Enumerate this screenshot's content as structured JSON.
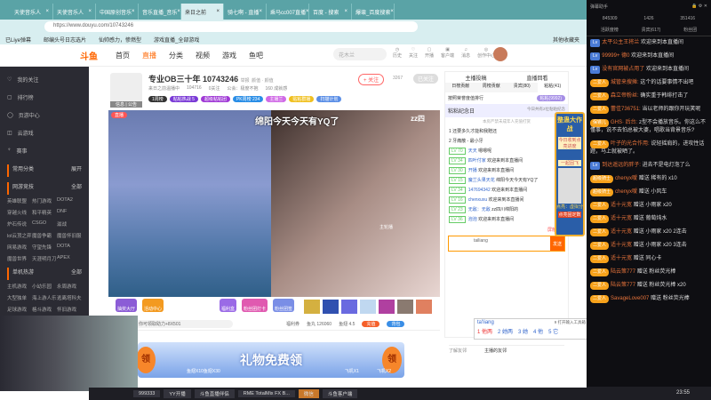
{
  "browser": {
    "tabs": [
      "天使音乐人",
      "天使音乐人",
      "中国原创音乐",
      "音乐直播_音乐",
      "来日之前",
      "骑七啊 - 直播",
      "乘马cc007直播",
      "百度 - 搜索",
      "爆壊_百度搜索"
    ],
    "active_tab": 4,
    "url": "https://www.douyu.com/10743246",
    "bookmarks": [
      "已Liye弹幕",
      "邮编头号日志选片",
      "仙帅感力，惨燃型",
      "游戏直播_全部游戏"
    ],
    "bookmarks_right": "其他收藏夹"
  },
  "header": {
    "logo": "斗鱼",
    "nav": [
      "首页",
      "直播",
      "分类",
      "视频",
      "游戏",
      "鱼吧"
    ],
    "search_placeholder": "花木兰",
    "icons": [
      "历史",
      "关注",
      "开播",
      "客户端",
      "消息",
      "创作中心"
    ]
  },
  "sidebar": {
    "items": [
      "我的关注",
      "排行榜",
      "页游中心",
      "云游戏",
      "赛事"
    ],
    "common": "常用分类",
    "common_more": "展开",
    "section1": "网游竞技",
    "section1_more": "全部",
    "games1": [
      "英雄联盟",
      "热门游戏",
      "DOTA2",
      "穿越火线",
      "和平精英",
      "DNF",
      "炉石传说",
      "CSGO",
      "滋战",
      "lol云顶之弈",
      "魔兽争霸",
      "魔兽怀旧服",
      "网易游戏",
      "守望先锋",
      "DOTA",
      "魔兽世界",
      "天涯明月刀",
      "APEX"
    ],
    "section2": "单机热游",
    "section2_more": "全部",
    "games2": [
      "主机游戏",
      "小幼乐园",
      "永周游戏",
      "大型独单",
      "海上游人乐",
      "逃离塔科夫",
      "足球游戏",
      "格斗游戏",
      "怀旧游戏"
    ]
  },
  "streamer": {
    "name": "专业OB三十年",
    "room": "10743246",
    "report": "举报",
    "tags": "颜值 · 颜值",
    "category": "来日之前温播中",
    "heat": "104716",
    "fans": "0关注",
    "notice": "公会：极度不抱",
    "rank": "160 成就感",
    "follow": "+ 关注",
    "follow_count": "3267",
    "followed": "已关注",
    "avatar_label": "信息 | 公告",
    "badges": [
      "1周榜",
      "粘粘热战 5",
      "超级粘粘团",
      "PK周榜 234",
      "主播兰",
      "贴粘群播",
      "扫描计划"
    ]
  },
  "video": {
    "live_badge": "直播",
    "title": "绵阳今天今天有YQ了",
    "streamer_tag": "zz四",
    "watermark": "主轮播"
  },
  "gifts": {
    "left": [
      "抽奖大厅",
      "活动中心"
    ],
    "mid": [
      "福利盒",
      "粉丝团打卡",
      "粉丝团签"
    ],
    "input_hint": "你可领取助力+8X501",
    "welfare": "福利券",
    "fish_balls": "鱼丸 126060",
    "fish_wings": "鱼翅 4.5",
    "recharge": "充值",
    "backpack": "背包"
  },
  "banner": {
    "title": "礼物免费领",
    "left": "领",
    "right": "领",
    "items": [
      "鱼翅X10",
      "鱼翅X30",
      "飞机X1",
      "飞机X2"
    ]
  },
  "right_panel": {
    "top": [
      "主播投稿",
      "直播回看"
    ],
    "tabs": [
      "日榜贡献",
      "周榜贡献",
      "贵宾(80)",
      "粘粘(41)"
    ],
    "rank_desc": "按照荣誉度值排行",
    "my_btn": "粘粘(9992)",
    "club": "粘粘纪念日",
    "club_sub": "今日共有2位粘粘纪念",
    "notice": "本房严禁未成年人充值打赏",
    "rank": [
      {
        "n": "1",
        "name": "还要多久才能和我赔还"
      },
      {
        "n": "2",
        "name": "牙痛散 - 最小牙"
      }
    ],
    "messages": [
      {
        "lv": "LV 70",
        "user": "天天",
        "text": "嗯嗯呢"
      },
      {
        "lv": "LV 34",
        "user": "四叶付家",
        "text": "欢迎来到本直播间"
      },
      {
        "lv": "LV 30",
        "user": "开播",
        "text": "欢迎来到本直播间"
      },
      {
        "lv": "LV 15",
        "user": "魔兰头果天花",
        "text": "绵阳今天今天有YQ了"
      },
      {
        "lv": "LV 34",
        "user": "147694342",
        "text": "欢迎来到本直播间"
      },
      {
        "lv": "LV 16",
        "user": "chenxuxu",
        "text": "欢迎来到本直播间"
      },
      {
        "lv": "LV 23",
        "user": "无敌：无敌",
        "text": "zz四川绵阳的"
      },
      {
        "lv": "LV 36",
        "user": "泡泡",
        "text": "欢迎来到本直播间"
      }
    ],
    "effects": "屏蔽特效",
    "input": "tailiang",
    "send": "发送",
    "friend_label": "了解友邻",
    "friend_text": "主播的友邻",
    "promo": "整蛊大作战",
    "promo2": "今日收到点亮进度",
    "promo3": "一起固飞",
    "promo4": "点亮：虚拟分",
    "promo_btn": "点亮固定数"
  },
  "ime": {
    "pinyin": "ta'liang",
    "tool": "9 打开输入工具箱",
    "candidates": [
      "1 他两",
      "2 她两",
      "3 她",
      "4 他",
      "5 它"
    ]
  },
  "chat": {
    "title": "弹幕助手",
    "stats": [
      "845309",
      "1426",
      "351416"
    ],
    "tabs": [
      "活跃度榜",
      "贵宾(617)",
      "粉丝团"
    ],
    "messages": [
      {
        "badge": "",
        "lv": "",
        "user": "太平公主王将兰",
        "text": "欢迎来到本直播间"
      },
      {
        "badge": "",
        "lv": "",
        "user": "99999+ 德0",
        "text": "欢迎来到本直播间"
      },
      {
        "badge": "",
        "lv": "",
        "user": "没有官网被占用了",
        "text": "欢迎来到本直播间"
      },
      {
        "badge": "二爱人",
        "lv": "",
        "user": "城管来搜摊:",
        "text": "这个的话要事情不出吧"
      },
      {
        "badge": "二爱人",
        "lv": "",
        "user": "森立帝粉丝:",
        "text": "确实重于韩绯打击了"
      },
      {
        "badge": "二爱人",
        "lv": "",
        "user": "蕾佳736751:",
        "text": "当以老师的跟你开玩笑呢"
      },
      {
        "badge": "保镖儿",
        "lv": "",
        "user": "GHS· 后台:",
        "text": "z型不会播放音乐。你这么不懂事，说不去怕总被大婆，唱歌当背景音乐?"
      },
      {
        "badge": "二爱人",
        "lv": "",
        "user": "叶子的光合作用:",
        "text": "说轻摇肩的，进攻性话题，马上就被晒了。"
      },
      {
        "badge": "",
        "lv": "",
        "user": "到达遥远的胖子:",
        "text": "进去不是电灯泡了么"
      },
      {
        "badge": "超级骑士",
        "lv": "",
        "user": "chenyx嗳",
        "text": "赠送 稀有的 x10"
      },
      {
        "badge": "超级骑士",
        "lv": "",
        "user": "chenyx嗳",
        "text": "赠送 小风车"
      },
      {
        "badge": "二爱人",
        "lv": "",
        "user": "适十元宽",
        "text": "赠送 小雨家 x20"
      },
      {
        "badge": "二爱人",
        "lv": "",
        "user": "适十元宽",
        "text": "赠送 葡萄炖水"
      },
      {
        "badge": "二爱人",
        "lv": "",
        "user": "适十元宽",
        "text": "赠送 小雨家 x20 2连击"
      },
      {
        "badge": "二爱人",
        "lv": "",
        "user": "适十元宽",
        "text": "赠送 小雨家 x20 3连击"
      },
      {
        "badge": "二爱人",
        "lv": "",
        "user": "适十元宽",
        "text": "赠送 同心卡"
      },
      {
        "badge": "二爱人",
        "lv": "",
        "user": "陆云策777",
        "text": "赠送 粉丝荧光棒"
      },
      {
        "badge": "二爱人",
        "lv": "",
        "user": "陆云策777",
        "text": "赠送 粉丝荧光棒 x20"
      },
      {
        "badge": "二爱人",
        "lv": "",
        "user": "SavageLove007",
        "text": "赠送 粉丝荧光棒"
      }
    ]
  },
  "taskbar": {
    "items": [
      "999333",
      "YY开播",
      "斗鱼直播伴侣",
      "RME TotalMix FX B...",
      "微信",
      "斗鱼客户端"
    ],
    "active": 4,
    "time": "23:55"
  }
}
